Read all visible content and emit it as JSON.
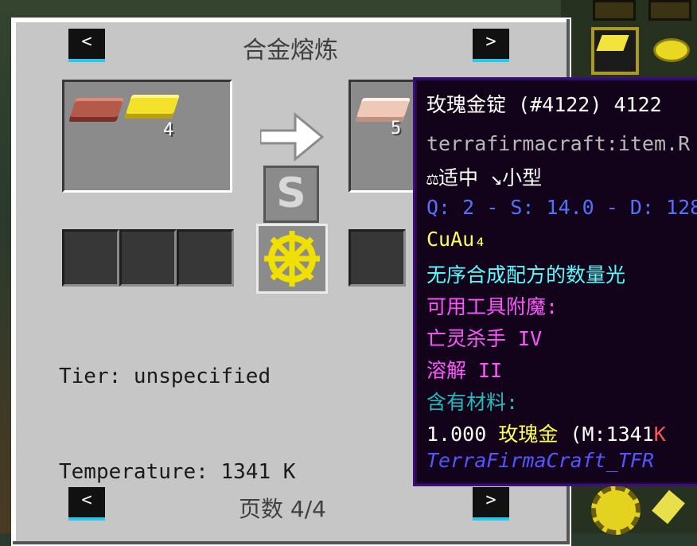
{
  "header": {
    "title": "合金熔炼",
    "prev_label": "<",
    "next_label": ">"
  },
  "recipe": {
    "inputs": [
      {
        "icon": "copper-ingot-icon",
        "count": ""
      },
      {
        "icon": "gold-ingot-icon",
        "count": "4"
      }
    ],
    "output": {
      "icon": "rose-gold-ingot-icon",
      "count": "5"
    },
    "shapeless_label": "S"
  },
  "info": {
    "tier": "Tier: unspecified",
    "temperature": "Temperature: 1341 K"
  },
  "footer": {
    "page": "页数 4/4",
    "prev_label": "<",
    "next_label": ">"
  },
  "tooltip": {
    "name": "玫瑰金锭 (#4122) 4122",
    "registry": "terrafirmacraft:item.R",
    "size_weight": "⚖适中 ↘小型",
    "stats": "Q: 2 - S: 14.0 - D: 128",
    "formula": "CuAu₄",
    "shapeless_note": "无序合成配方的数量光",
    "enchant_header": "可用工具附魔:",
    "enchant_1": "亡灵杀手 IV",
    "enchant_2": "溶解 II",
    "material_header": "含有材料:",
    "material_amount": "1.000",
    "material_name": "玫瑰金",
    "material_melt_open": "(M:",
    "material_melt_value": "1341",
    "material_melt_unit": "K",
    "mod_name": "TerraFirmaCraft_TFR"
  },
  "colors": {
    "rose_gold": "#f0c8b8",
    "gold": "#f8ec30",
    "copper": "#c06050",
    "tip_white": "#ffffff",
    "tip_gray": "#b8b8b8",
    "tip_blue": "#5570ff",
    "tip_yellow": "#ffff55",
    "tip_aqua": "#55ffff",
    "tip_magenta": "#ff55ff",
    "tip_teal": "#22bbbb",
    "tip_red": "#ff5555",
    "tip_mod": "#5555ff"
  }
}
